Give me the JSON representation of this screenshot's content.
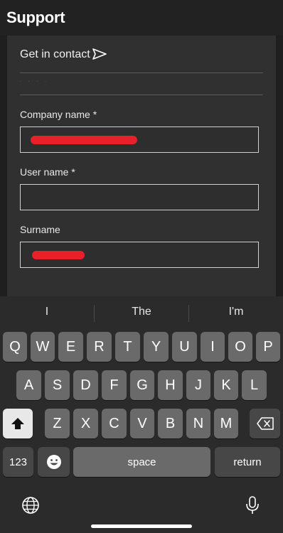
{
  "header": {
    "title": "Support"
  },
  "form": {
    "contact_label": "Get in contact",
    "company_label": "Company name *",
    "user_label": "User name *",
    "surname_label": "Surname",
    "company_value": "",
    "user_value": "",
    "surname_value": ""
  },
  "keyboard": {
    "suggestions": [
      "I",
      "The",
      "I'm"
    ],
    "row1": [
      "Q",
      "W",
      "E",
      "R",
      "T",
      "Y",
      "U",
      "I",
      "O",
      "P"
    ],
    "row2": [
      "A",
      "S",
      "D",
      "F",
      "G",
      "H",
      "J",
      "K",
      "L"
    ],
    "row3": [
      "Z",
      "X",
      "C",
      "V",
      "B",
      "N",
      "M"
    ],
    "numbers_label": "123",
    "space_label": "space",
    "return_label": "return"
  },
  "colors": {
    "redaction": "#e8202a",
    "background": "#1f1f1f",
    "panel": "#303030"
  }
}
